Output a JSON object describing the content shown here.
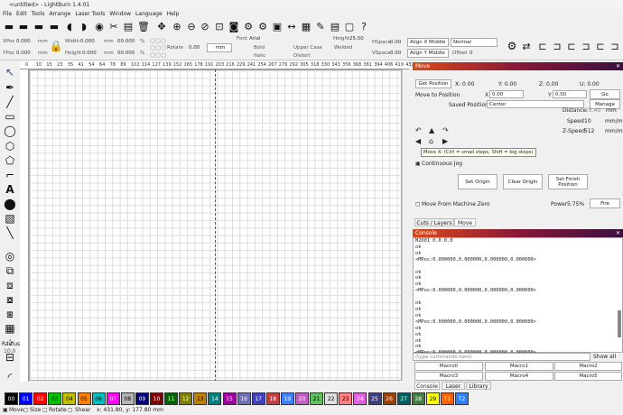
{
  "window": {
    "title": "<untitled> - LightBurn 1.4.01"
  },
  "menu": [
    "File",
    "Edit",
    "Tools",
    "Arrange",
    "Laser Tools",
    "Window",
    "Language",
    "Help"
  ],
  "props": {
    "xpos_label": "XPos",
    "xpos": "0.000",
    "ypos_label": "YPos",
    "ypos": "0.000",
    "mm": "mm",
    "width_label": "Width",
    "width": "0.000",
    "height_label": "Height",
    "height": "0.000",
    "pct1": "00.000",
    "pct2": "00.000",
    "pct_sign": "%",
    "rotate_label": "Rotate",
    "rotate": "0.00",
    "unit_mm": "mm",
    "font_label": "Font",
    "font": "Arial",
    "height_font_label": "Height",
    "height_font": "25.00",
    "bold": "Bold",
    "italic": "Italic",
    "upper_case": "Upper Case",
    "distort": "Distort",
    "welded": "Welded",
    "hspace_label": "HSpace",
    "hspace": "0.00",
    "vspace_label": "VSpace",
    "vspace": "0.00",
    "align_x": "Align X Middle",
    "align_y": "Align Y Middle",
    "normal": "Normal",
    "offset_label": "Offset",
    "offset": "0"
  },
  "ruler": {
    "top": [
      "0",
      "10",
      "15",
      "23",
      "35",
      "41",
      "54",
      "64",
      "78",
      "89",
      "102",
      "114",
      "127",
      "139",
      "152",
      "165",
      "178",
      "191",
      "203",
      "216",
      "229",
      "241",
      "254",
      "267",
      "279",
      "292",
      "305",
      "318",
      "330",
      "343",
      "356",
      "368",
      "381",
      "394",
      "406",
      "419",
      "432"
    ]
  },
  "radius": {
    "label": "Radius:",
    "value": "10.0"
  },
  "move": {
    "title": "Move",
    "get_position": "Get Position",
    "x": "X: 0.00",
    "y": "Y: 0.00",
    "z": "Z: 0.00",
    "u": "U: 0.00",
    "move_to_position": "Move to Position",
    "x_label": "X",
    "x_val": "0.00",
    "y_label": "Y",
    "y_val": "0.00",
    "go": "Go",
    "saved_positions": "Saved Positions:",
    "saved_value": "Center",
    "manage": "Manage",
    "distance_label": "Distance",
    "distance": "25.40",
    "dist_unit": "mm",
    "speed_label": "Speed",
    "speed": "10",
    "speed_unit": "mm/m",
    "zspeed_label": "Z-Speed",
    "zspeed": "512",
    "zspeed_unit": "mm/m",
    "tooltip": "Move X- (Ctrl = small steps, Shift = big steps)",
    "continuous_jog": "Continuous Jog",
    "set_origin": "Set Origin",
    "clear_origin": "Clear Origin",
    "set_finish": "Set Finish Position",
    "move_from_zero": "Move From Machine Zero",
    "power_label": "Power",
    "power": "5.75%",
    "fire": "Fire"
  },
  "tabs_mid": [
    "Cuts / Layers",
    "Move"
  ],
  "console": {
    "title": "Console",
    "lines": [
      "M2001 0.0.0.0",
      "ok",
      "ok",
      "<MPos:0.000000,0.000000,0.000000,0.000000>",
      "",
      "ok",
      "ok",
      "ok",
      "<MPos:0.000000,0.000000,0.000000,0.000000>",
      "",
      "ok",
      "ok",
      "ok",
      "<MPos:0.000000,0.000000,0.000000,0.000000>",
      "ok",
      "ok",
      "ok",
      "ok",
      "<MPos:0.000000,0.000000,0.000000,0.000000>"
    ],
    "placeholder": "(type commands here)",
    "show_all": "Show all"
  },
  "macros": [
    "Macro0",
    "Macro1",
    "Macro2",
    "Macro3",
    "Macro4",
    "Macro5"
  ],
  "tabs_bottom": [
    "Console",
    "Laser",
    "Library"
  ],
  "palette": [
    {
      "label": "00",
      "color": "#000000"
    },
    {
      "label": "01",
      "color": "#0000ff"
    },
    {
      "label": "02",
      "color": "#ff0000"
    },
    {
      "label": "03",
      "color": "#00c000"
    },
    {
      "label": "04",
      "color": "#c0c000"
    },
    {
      "label": "05",
      "color": "#ff8000"
    },
    {
      "label": "06",
      "color": "#00c0c0"
    },
    {
      "label": "07",
      "color": "#ff00ff"
    },
    {
      "label": "08",
      "color": "#b4b4b4"
    },
    {
      "label": "09",
      "color": "#000080"
    },
    {
      "label": "10",
      "color": "#800000"
    },
    {
      "label": "11",
      "color": "#006400"
    },
    {
      "label": "12",
      "color": "#808000"
    },
    {
      "label": "13",
      "color": "#c08000"
    },
    {
      "label": "14",
      "color": "#008080"
    },
    {
      "label": "15",
      "color": "#a000a0"
    },
    {
      "label": "16",
      "color": "#7070b0"
    },
    {
      "label": "17",
      "color": "#4040c0"
    },
    {
      "label": "18",
      "color": "#c04040"
    },
    {
      "label": "19",
      "color": "#4080ff"
    },
    {
      "label": "20",
      "color": "#c060c0"
    },
    {
      "label": "21",
      "color": "#60c060"
    },
    {
      "label": "22",
      "color": "#e0e0e0"
    },
    {
      "label": "23",
      "color": "#ff8080"
    },
    {
      "label": "24",
      "color": "#e060e0"
    },
    {
      "label": "25",
      "color": "#404080"
    },
    {
      "label": "26",
      "color": "#a04000"
    },
    {
      "label": "27",
      "color": "#006060"
    },
    {
      "label": "28",
      "color": "#408040"
    },
    {
      "label": "29",
      "color": "#ffff00"
    },
    {
      "label": "T1",
      "color": "#ff6000"
    },
    {
      "label": "T2",
      "color": "#3080ff"
    }
  ],
  "status": {
    "move": "Move",
    "size": "Size",
    "rotate": "Rotate",
    "shear": "Shear",
    "coords": "x: 431.80, y: 177.80 mm"
  }
}
